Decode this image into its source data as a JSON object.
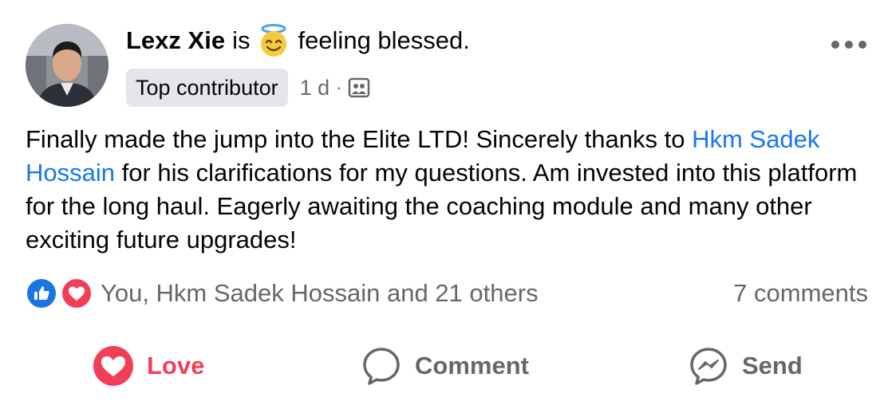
{
  "post": {
    "author": "Lexz Xie",
    "verb": "is",
    "feeling": "feeling blessed.",
    "feeling_emoji": "smiling-face-with-halo",
    "badge": "Top contributor",
    "time": "1 d",
    "separator": "·",
    "audience_icon": "group-audience-icon",
    "text_before_mention": "Finally made the jump into the Elite LTD! Sincerely thanks to ",
    "mention": "Hkm Sadek Hossain",
    "text_after_mention": " for his clarifications for my questions. Am invested into this platform for the long haul. Eagerly awaiting the coaching module and many other exciting future upgrades!"
  },
  "reactions": {
    "types": [
      "like",
      "love"
    ],
    "summary": "You, Hkm Sadek Hossain and 21 others",
    "comments": "7 comments"
  },
  "actions": {
    "love": "Love",
    "comment": "Comment",
    "send": "Send"
  },
  "colors": {
    "mention": "#1877f2",
    "love": "#f33e58",
    "like": "#1b74e4",
    "secondary_text": "#65676b",
    "badge_bg": "#e4e6eb"
  }
}
